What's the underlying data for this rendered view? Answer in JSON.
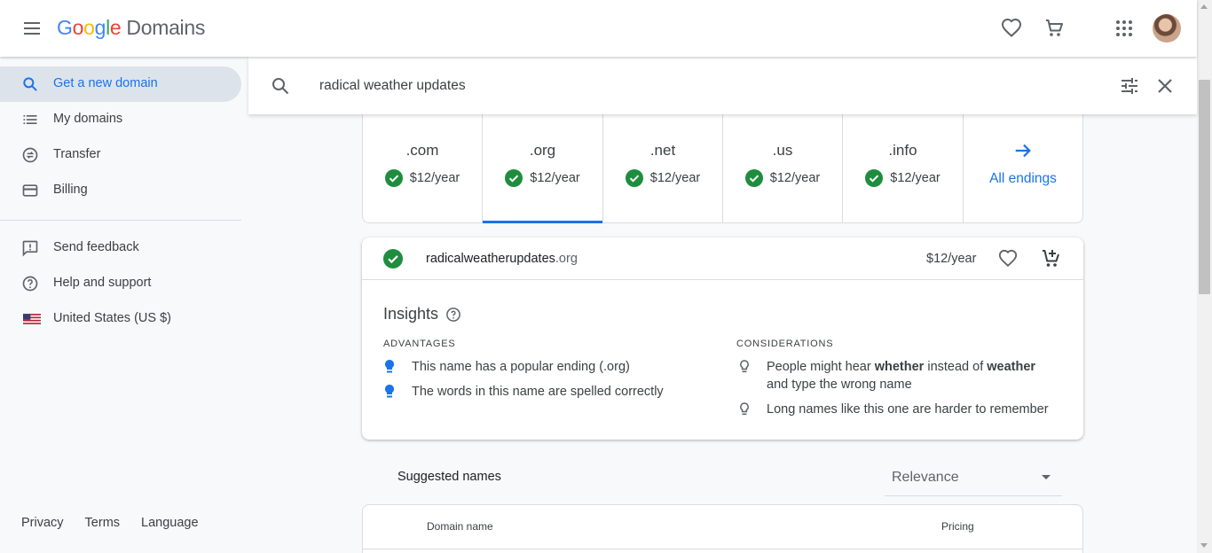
{
  "app": {
    "logo_letters": [
      "G",
      "o",
      "o",
      "g",
      "l",
      "e"
    ],
    "product": "Domains",
    "menu_icon": "menu-icon",
    "favorites_icon": "heart-icon",
    "cart_icon": "cart-icon",
    "apps_icon": "apps-grid-icon"
  },
  "sidebar": {
    "items": [
      {
        "label": "Get a new domain",
        "icon": "search-icon",
        "active": true
      },
      {
        "label": "My domains",
        "icon": "list-icon"
      },
      {
        "label": "Transfer",
        "icon": "transfer-icon"
      },
      {
        "label": "Billing",
        "icon": "credit-card-icon"
      }
    ],
    "secondary": [
      {
        "label": "Send feedback",
        "icon": "feedback-icon"
      },
      {
        "label": "Help and support",
        "icon": "help-icon"
      },
      {
        "label": "United States (US $)",
        "icon": "us-flag-icon"
      }
    ],
    "footer": {
      "privacy": "Privacy",
      "terms": "Terms",
      "language": "Language"
    }
  },
  "search": {
    "query": "radical weather updates"
  },
  "endings": [
    {
      "tld": ".com",
      "price": "$12/year"
    },
    {
      "tld": ".org",
      "price": "$12/year",
      "active": true
    },
    {
      "tld": ".net",
      "price": "$12/year"
    },
    {
      "tld": ".us",
      "price": "$12/year"
    },
    {
      "tld": ".info",
      "price": "$12/year"
    }
  ],
  "all_endings": "All endings",
  "result": {
    "name": "radicalweatherupdates",
    "tld": ".org",
    "price": "$12/year"
  },
  "insights": {
    "title": "Insights",
    "advantages_heading": "ADVANTAGES",
    "advantages": [
      "This name has a popular ending (.org)",
      "The words in this name are spelled correctly"
    ],
    "considerations_heading": "CONSIDERATIONS",
    "consideration_1": {
      "a": "People might hear ",
      "b": "whether",
      "c": " instead of ",
      "d": "weather",
      "e": " and type the wrong name"
    },
    "consideration_2": "Long names like this one are harder to remember"
  },
  "suggested": {
    "title": "Suggested names",
    "sort_value": "Relevance",
    "col_domain": "Domain name",
    "col_pricing": "Pricing"
  },
  "colors": {
    "accent": "#1a73e8",
    "available_green": "#1e8e3e",
    "active_nav_bg": "#dde3ea"
  }
}
